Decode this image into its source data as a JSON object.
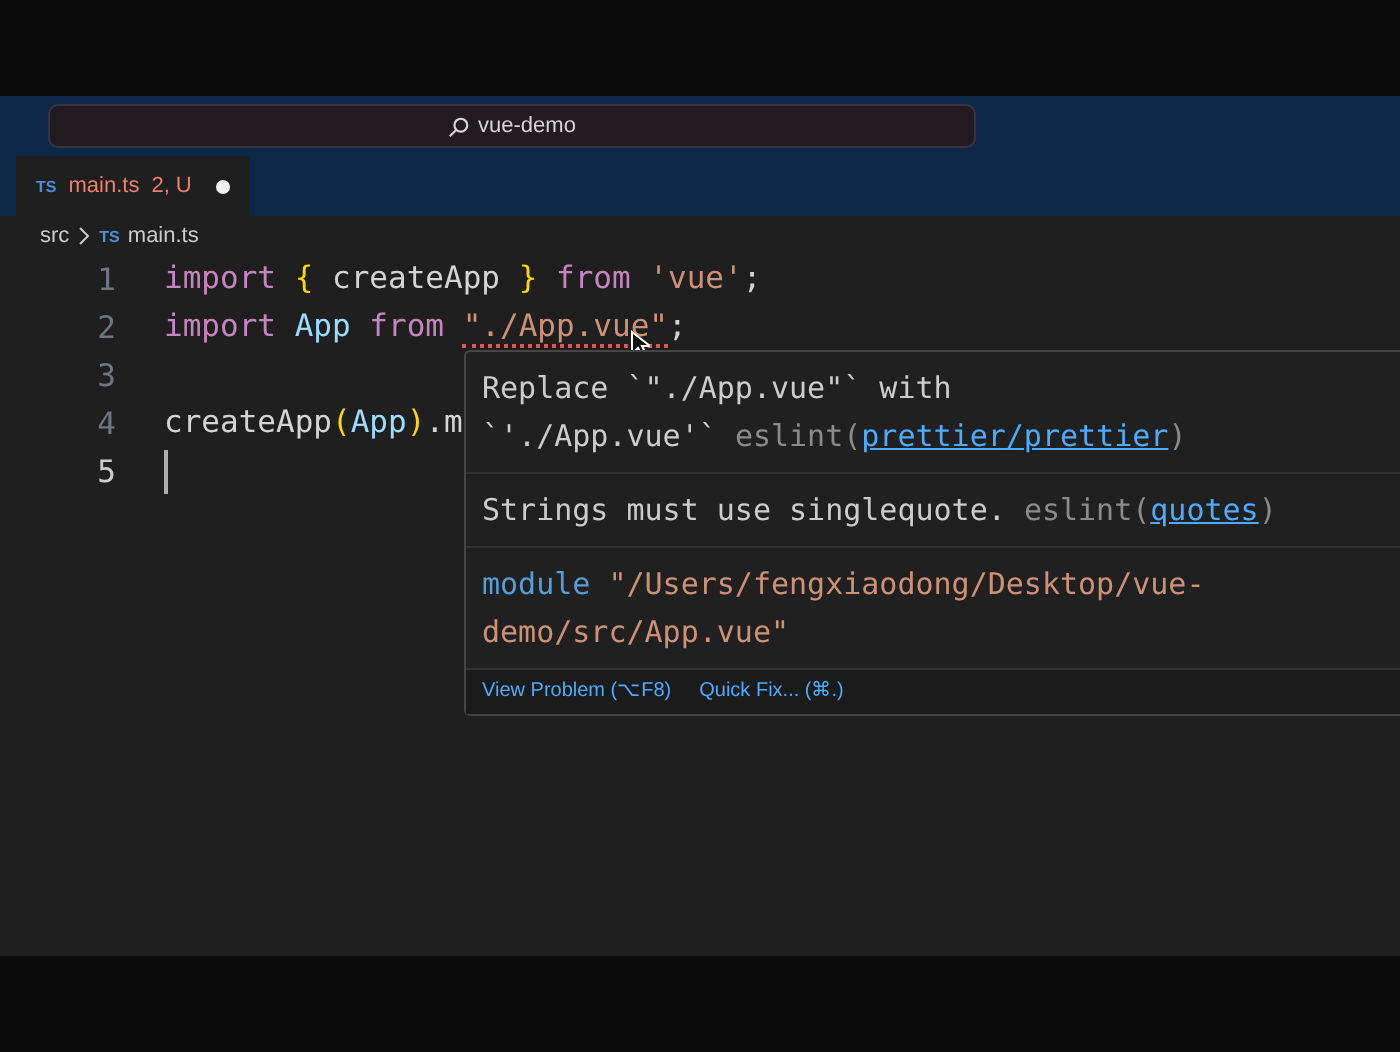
{
  "title_bar": {
    "search": "vue-demo"
  },
  "tabs": [
    {
      "icon": "TS",
      "label": "main.ts",
      "badge": "2, U",
      "selected": true,
      "dirty": true
    }
  ],
  "breadcrumb": [
    {
      "label": "src"
    },
    {
      "icon": "TS",
      "label": "main.ts"
    }
  ],
  "editor": {
    "lines": [
      {
        "number": "1",
        "active": false,
        "tokens": [
          {
            "kind": "keyword",
            "text": "import ",
            "error": false
          },
          {
            "kind": "bracket",
            "text": "{",
            "error": false
          },
          {
            "kind": "plain",
            "text": " createApp ",
            "error": false
          },
          {
            "kind": "bracket",
            "text": "}",
            "error": false
          },
          {
            "kind": "keyword",
            "text": " from ",
            "error": false
          },
          {
            "kind": "string",
            "text": "'vue'",
            "error": false
          },
          {
            "kind": "plain",
            "text": ";",
            "error": false
          }
        ]
      },
      {
        "number": "2",
        "active": false,
        "tokens": [
          {
            "kind": "keyword",
            "text": "import ",
            "error": false
          },
          {
            "kind": "variable",
            "text": "App ",
            "error": false
          },
          {
            "kind": "keyword",
            "text": "from ",
            "error": false
          },
          {
            "kind": "string",
            "text": "\"./App.vue\"",
            "error": true
          },
          {
            "kind": "plain",
            "text": ";",
            "error": false
          }
        ]
      },
      {
        "number": "3",
        "active": false
      },
      {
        "number": "4",
        "active": false,
        "tokens": [
          {
            "kind": "plain",
            "text": "createApp",
            "error": false
          },
          {
            "kind": "bracket",
            "text": "(",
            "error": false
          },
          {
            "kind": "variable",
            "text": "App",
            "error": false
          },
          {
            "kind": "bracket",
            "text": ")",
            "error": false
          },
          {
            "kind": "plain",
            "text": ".m",
            "error": false
          }
        ]
      },
      {
        "number": "5",
        "active": true
      }
    ]
  },
  "hover": {
    "diagnostics": [
      {
        "message": "Replace `\"./App.vue\"` with `'./App.vue'`",
        "source": "eslint(",
        "code": "prettier/prettier",
        "close": ")"
      },
      {
        "message": "Strings must use singlequote.",
        "source": "eslint(",
        "code": "quotes",
        "close": ")"
      }
    ],
    "module": {
      "keyword": "module",
      "path": "\"/Users/fengxiaodong/Desktop/vue-demo/src/App.vue\""
    },
    "actions": [
      "View Problem (⌥F8)",
      "Quick Fix... (⌘.)"
    ]
  }
}
